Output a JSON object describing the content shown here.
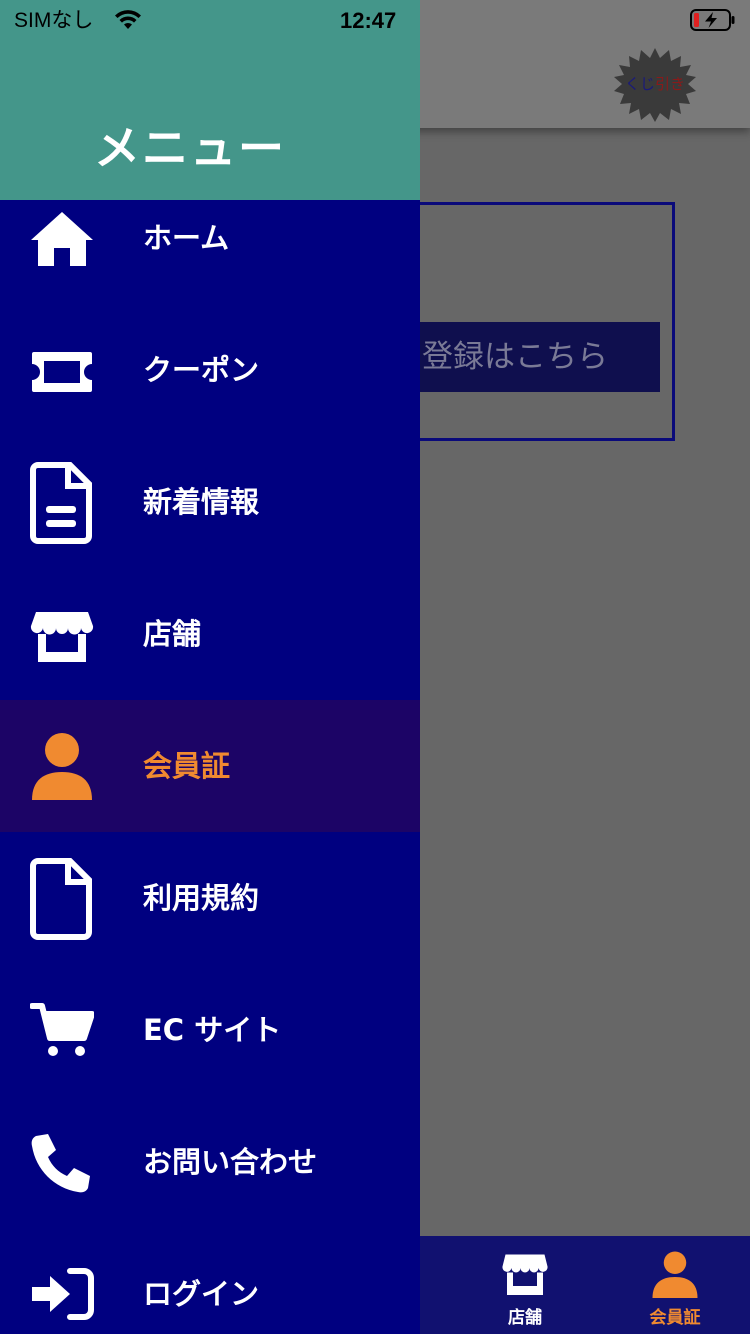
{
  "status_bar": {
    "carrier": "SIMなし",
    "time": "12:47"
  },
  "background": {
    "kuji_label_a": "くじ",
    "kuji_label_b": "引き",
    "register_button": "登録はこちら",
    "tabs": [
      {
        "label": "店舗",
        "icon": "store-icon"
      },
      {
        "label": "会員証",
        "icon": "person-icon"
      }
    ]
  },
  "drawer": {
    "title": "メニュー",
    "items": [
      {
        "label": "ホーム",
        "icon": "home-icon"
      },
      {
        "label": "クーポン",
        "icon": "ticket-icon"
      },
      {
        "label": "新着情報",
        "icon": "document-icon"
      },
      {
        "label": "店舗",
        "icon": "store-icon"
      },
      {
        "label": "会員証",
        "icon": "person-icon",
        "active": true
      },
      {
        "label": "利用規約",
        "icon": "file-icon"
      },
      {
        "label": "EC サイト",
        "icon": "cart-icon"
      },
      {
        "label": "お問い合わせ",
        "icon": "phone-icon"
      },
      {
        "label": "ログイン",
        "icon": "login-icon"
      }
    ]
  },
  "colors": {
    "drawer_bg": "#000080",
    "header_bg": "#44968a",
    "active_bg": "#1c0466",
    "accent": "#f08a30",
    "overlay": "#676767"
  }
}
